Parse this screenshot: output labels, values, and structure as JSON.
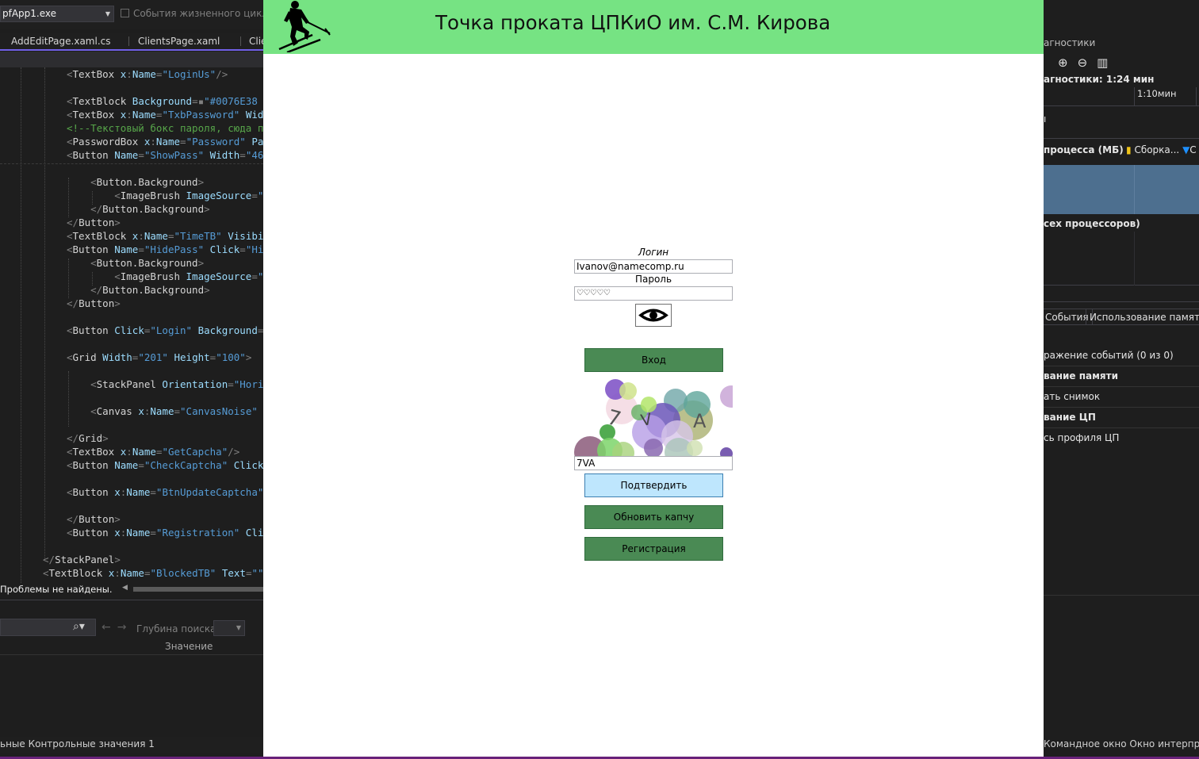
{
  "ide_left": {
    "process_select": "pfApp1.exe",
    "lifecycle_events_label": "События жизненного цикла",
    "tabs": [
      {
        "label": "AddEditPage.xaml.cs"
      },
      {
        "label": "ClientsPage.xaml"
      },
      {
        "label": "Clie"
      }
    ],
    "code_lines": [
      [
        {
          "t": "<",
          "c": "c-br"
        },
        {
          "t": "TextBox",
          "c": "c-tag"
        },
        {
          "t": " x",
          "c": "c-attr"
        },
        {
          "t": ":",
          "c": "c-br"
        },
        {
          "t": "Name",
          "c": "c-attr"
        },
        {
          "t": "=",
          "c": "c-br"
        },
        {
          "t": "\"LoginUs\"",
          "c": "c-ns"
        },
        {
          "t": "/>",
          "c": "c-br"
        }
      ],
      [],
      [
        {
          "t": "<",
          "c": "c-br"
        },
        {
          "t": "TextBlock",
          "c": "c-tag"
        },
        {
          "t": " Background",
          "c": "c-attr"
        },
        {
          "t": "=",
          "c": "c-br"
        },
        {
          "t": "▪",
          "c": "c-br"
        },
        {
          "t": "\"#0076E38",
          "c": "c-ns"
        }
      ],
      [
        {
          "t": "<",
          "c": "c-br"
        },
        {
          "t": "TextBox",
          "c": "c-tag"
        },
        {
          "t": " x",
          "c": "c-attr"
        },
        {
          "t": ":",
          "c": "c-br"
        },
        {
          "t": "Name",
          "c": "c-attr"
        },
        {
          "t": "=",
          "c": "c-br"
        },
        {
          "t": "\"TxbPassword\"",
          "c": "c-ns"
        },
        {
          "t": " Wid",
          "c": "c-attr"
        }
      ],
      [
        {
          "t": "<!--Текстовый бокс пароля, сюда п",
          "c": "c-com"
        }
      ],
      [
        {
          "t": "<",
          "c": "c-br"
        },
        {
          "t": "PasswordBox",
          "c": "c-tag"
        },
        {
          "t": " x",
          "c": "c-attr"
        },
        {
          "t": ":",
          "c": "c-br"
        },
        {
          "t": "Name",
          "c": "c-attr"
        },
        {
          "t": "=",
          "c": "c-br"
        },
        {
          "t": "\"Password\"",
          "c": "c-ns"
        },
        {
          "t": " Pa",
          "c": "c-attr"
        }
      ],
      [
        {
          "t": "<",
          "c": "c-br"
        },
        {
          "t": "Button",
          "c": "c-tag"
        },
        {
          "t": " Name",
          "c": "c-attr"
        },
        {
          "t": "=",
          "c": "c-br"
        },
        {
          "t": "\"ShowPass\"",
          "c": "c-ns"
        },
        {
          "t": " Width",
          "c": "c-attr"
        },
        {
          "t": "=",
          "c": "c-br"
        },
        {
          "t": "\"46",
          "c": "c-ns"
        }
      ],
      [],
      [
        {
          "t": "    <",
          "c": "c-br"
        },
        {
          "t": "Button.Background",
          "c": "c-tag"
        },
        {
          "t": ">",
          "c": "c-br"
        }
      ],
      [
        {
          "t": "        <",
          "c": "c-br"
        },
        {
          "t": "ImageBrush",
          "c": "c-tag"
        },
        {
          "t": " ImageSource",
          "c": "c-attr"
        },
        {
          "t": "=",
          "c": "c-br"
        },
        {
          "t": "\"",
          "c": "c-ns"
        }
      ],
      [
        {
          "t": "    </",
          "c": "c-br"
        },
        {
          "t": "Button.Background",
          "c": "c-tag"
        },
        {
          "t": ">",
          "c": "c-br"
        }
      ],
      [
        {
          "t": "</",
          "c": "c-br"
        },
        {
          "t": "Button",
          "c": "c-tag"
        },
        {
          "t": ">",
          "c": "c-br"
        }
      ],
      [
        {
          "t": "<",
          "c": "c-br"
        },
        {
          "t": "TextBlock",
          "c": "c-tag"
        },
        {
          "t": " x",
          "c": "c-attr"
        },
        {
          "t": ":",
          "c": "c-br"
        },
        {
          "t": "Name",
          "c": "c-attr"
        },
        {
          "t": "=",
          "c": "c-br"
        },
        {
          "t": "\"TimeTB\"",
          "c": "c-ns"
        },
        {
          "t": " Visibi",
          "c": "c-attr"
        }
      ],
      [
        {
          "t": "<",
          "c": "c-br"
        },
        {
          "t": "Button",
          "c": "c-tag"
        },
        {
          "t": " Name",
          "c": "c-attr"
        },
        {
          "t": "=",
          "c": "c-br"
        },
        {
          "t": "\"HidePass\"",
          "c": "c-ns"
        },
        {
          "t": " Click",
          "c": "c-attr"
        },
        {
          "t": "=",
          "c": "c-br"
        },
        {
          "t": "\"Hi",
          "c": "c-ns"
        }
      ],
      [
        {
          "t": "    <",
          "c": "c-br"
        },
        {
          "t": "Button.Background",
          "c": "c-tag"
        },
        {
          "t": ">",
          "c": "c-br"
        }
      ],
      [
        {
          "t": "        <",
          "c": "c-br"
        },
        {
          "t": "ImageBrush",
          "c": "c-tag"
        },
        {
          "t": " ImageSource",
          "c": "c-attr"
        },
        {
          "t": "=",
          "c": "c-br"
        },
        {
          "t": "\"",
          "c": "c-ns"
        }
      ],
      [
        {
          "t": "    </",
          "c": "c-br"
        },
        {
          "t": "Button.Background",
          "c": "c-tag"
        },
        {
          "t": ">",
          "c": "c-br"
        }
      ],
      [
        {
          "t": "</",
          "c": "c-br"
        },
        {
          "t": "Button",
          "c": "c-tag"
        },
        {
          "t": ">",
          "c": "c-br"
        }
      ],
      [],
      [
        {
          "t": "<",
          "c": "c-br"
        },
        {
          "t": "Button",
          "c": "c-tag"
        },
        {
          "t": " Click",
          "c": "c-attr"
        },
        {
          "t": "=",
          "c": "c-br"
        },
        {
          "t": "\"Login\"",
          "c": "c-ns"
        },
        {
          "t": " Background",
          "c": "c-attr"
        },
        {
          "t": "=",
          "c": "c-br"
        }
      ],
      [],
      [
        {
          "t": "<",
          "c": "c-br"
        },
        {
          "t": "Grid",
          "c": "c-tag"
        },
        {
          "t": " Width",
          "c": "c-attr"
        },
        {
          "t": "=",
          "c": "c-br"
        },
        {
          "t": "\"201\"",
          "c": "c-ns"
        },
        {
          "t": " Height",
          "c": "c-attr"
        },
        {
          "t": "=",
          "c": "c-br"
        },
        {
          "t": "\"100\"",
          "c": "c-ns"
        },
        {
          "t": ">",
          "c": "c-br"
        }
      ],
      [],
      [
        {
          "t": "    <",
          "c": "c-br"
        },
        {
          "t": "StackPanel",
          "c": "c-tag"
        },
        {
          "t": " Orientation",
          "c": "c-attr"
        },
        {
          "t": "=",
          "c": "c-br"
        },
        {
          "t": "\"Hori",
          "c": "c-ns"
        }
      ],
      [],
      [
        {
          "t": "    <",
          "c": "c-br"
        },
        {
          "t": "Canvas",
          "c": "c-tag"
        },
        {
          "t": " x",
          "c": "c-attr"
        },
        {
          "t": ":",
          "c": "c-br"
        },
        {
          "t": "Name",
          "c": "c-attr"
        },
        {
          "t": "=",
          "c": "c-br"
        },
        {
          "t": "\"CanvasNoise\"",
          "c": "c-ns"
        }
      ],
      [],
      [
        {
          "t": "</",
          "c": "c-br"
        },
        {
          "t": "Grid",
          "c": "c-tag"
        },
        {
          "t": ">",
          "c": "c-br"
        }
      ],
      [
        {
          "t": "<",
          "c": "c-br"
        },
        {
          "t": "TextBox",
          "c": "c-tag"
        },
        {
          "t": " x",
          "c": "c-attr"
        },
        {
          "t": ":",
          "c": "c-br"
        },
        {
          "t": "Name",
          "c": "c-attr"
        },
        {
          "t": "=",
          "c": "c-br"
        },
        {
          "t": "\"GetCapcha\"",
          "c": "c-ns"
        },
        {
          "t": "/>",
          "c": "c-br"
        }
      ],
      [
        {
          "t": "<",
          "c": "c-br"
        },
        {
          "t": "Button",
          "c": "c-tag"
        },
        {
          "t": " Name",
          "c": "c-attr"
        },
        {
          "t": "=",
          "c": "c-br"
        },
        {
          "t": "\"CheckCaptcha\"",
          "c": "c-ns"
        },
        {
          "t": " Click",
          "c": "c-attr"
        }
      ],
      [],
      [
        {
          "t": "<",
          "c": "c-br"
        },
        {
          "t": "Button",
          "c": "c-tag"
        },
        {
          "t": " x",
          "c": "c-attr"
        },
        {
          "t": ":",
          "c": "c-br"
        },
        {
          "t": "Name",
          "c": "c-attr"
        },
        {
          "t": "=",
          "c": "c-br"
        },
        {
          "t": "\"BtnUpdateCaptcha\"",
          "c": "c-ns"
        }
      ],
      [],
      [
        {
          "t": "</",
          "c": "c-br"
        },
        {
          "t": "Button",
          "c": "c-tag"
        },
        {
          "t": ">",
          "c": "c-br"
        }
      ],
      [
        {
          "t": "<",
          "c": "c-br"
        },
        {
          "t": "Button",
          "c": "c-tag"
        },
        {
          "t": " x",
          "c": "c-attr"
        },
        {
          "t": ":",
          "c": "c-br"
        },
        {
          "t": "Name",
          "c": "c-attr"
        },
        {
          "t": "=",
          "c": "c-br"
        },
        {
          "t": "\"Registration\"",
          "c": "c-ns"
        },
        {
          "t": " Cli",
          "c": "c-attr"
        }
      ],
      [],
      [
        {
          "t": "</",
          "c": "c-br"
        },
        {
          "t": "StackPanel",
          "c": "c-tag"
        },
        {
          "t": ">",
          "c": "c-br"
        }
      ],
      [
        {
          "t": "<",
          "c": "c-br"
        },
        {
          "t": "TextBlock",
          "c": "c-tag"
        },
        {
          "t": " x",
          "c": "c-attr"
        },
        {
          "t": ":",
          "c": "c-br"
        },
        {
          "t": "Name",
          "c": "c-attr"
        },
        {
          "t": "=",
          "c": "c-br"
        },
        {
          "t": "\"BlockedTB\"",
          "c": "c-ns"
        },
        {
          "t": " Text",
          "c": "c-attr"
        },
        {
          "t": "=",
          "c": "c-br"
        },
        {
          "t": "\"\"",
          "c": "c-ns"
        }
      ]
    ],
    "status": "Проблемы не найдены.",
    "search_depth_label": "Глубина поиска:",
    "value_column": "Значение",
    "bottom_tabs": "ьные    Контрольные значения 1"
  },
  "ide_right": {
    "title": "агностики",
    "session_time": "агностики: 1:24 мин",
    "ruler_label": "1:10мин",
    "memory_legend": "процесса (МБ)",
    "snapshot_legend": "Сборка...",
    "c_legend": "С",
    "cpu_label": "сех процессоров)",
    "tabs": [
      "События",
      "Использование памяти"
    ],
    "rows": [
      {
        "text": "ражение событий (0 из 0)",
        "bold": false
      },
      {
        "text": "вание памяти",
        "bold": true
      },
      {
        "text": "ать снимок",
        "bold": false
      },
      {
        "text": "вание ЦП",
        "bold": true
      },
      {
        "text": "сь профиля ЦП",
        "bold": false
      }
    ],
    "bottom_tabs": "Командное окно   Окно интерпрета"
  },
  "app": {
    "title": "Точка проката ЦПКиО им. С.М. Кирова",
    "header_color": "#76E383",
    "login_label": "Логин",
    "login_value": "Ivanov@namecomp.ru",
    "password_label": "Пароль",
    "password_mask": "♡♡♡♡♡",
    "show_password_icon": "eye-icon",
    "login_button": "Вход",
    "captcha_text": "7VA",
    "captcha_input": "7VA",
    "confirm_button": "Подтвердить",
    "update_captcha_button": "Обновить капчу",
    "registration_button": "Регистрация",
    "accent_button_color": "#4A8A54",
    "confirm_button_color": "#BEE6FD"
  }
}
